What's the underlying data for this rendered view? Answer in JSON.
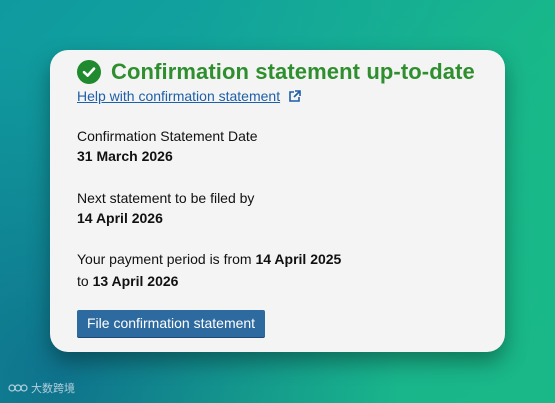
{
  "card": {
    "title": "Confirmation statement up-to-date",
    "status_icon": "check-circle-icon",
    "status_color": "#2f8f2f",
    "help_link": "Help with confirmation statement",
    "help_link_icon": "external-link-icon",
    "statement_date_label": "Confirmation Statement Date",
    "statement_date_value": "31 March 2026",
    "next_due_label": "Next statement to be filed by",
    "next_due_value": "14 April 2026",
    "payment_prefix": "Your payment period is from",
    "payment_from": "14 April 2025",
    "payment_to_prefix": "to",
    "payment_to": "13 April 2026",
    "file_button_label": "File confirmation statement",
    "button_color": "#2d6aa0"
  },
  "watermark": {
    "text": "大数跨境",
    "logo_icon": "watermark-logo-icon"
  }
}
